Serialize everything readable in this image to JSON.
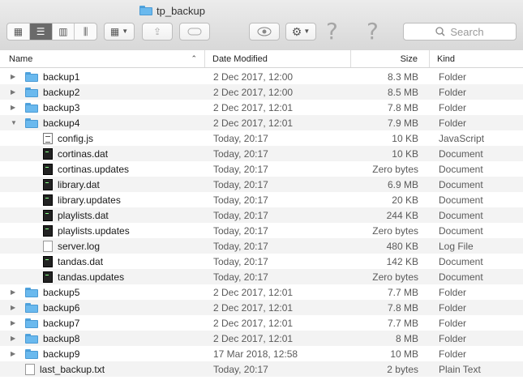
{
  "window": {
    "title": "tp_backup",
    "search_placeholder": "Search"
  },
  "columns": {
    "name": "Name",
    "date": "Date Modified",
    "size": "Size",
    "kind": "Kind"
  },
  "rows": [
    {
      "name": "backup1",
      "date": "2 Dec 2017, 12:00",
      "size": "8.3 MB",
      "kind": "Folder",
      "type": "folder",
      "level": 0,
      "expanded": false
    },
    {
      "name": "backup2",
      "date": "2 Dec 2017, 12:00",
      "size": "8.5 MB",
      "kind": "Folder",
      "type": "folder",
      "level": 0,
      "expanded": false
    },
    {
      "name": "backup3",
      "date": "2 Dec 2017, 12:01",
      "size": "7.8 MB",
      "kind": "Folder",
      "type": "folder",
      "level": 0,
      "expanded": false
    },
    {
      "name": "backup4",
      "date": "2 Dec 2017, 12:01",
      "size": "7.9 MB",
      "kind": "Folder",
      "type": "folder",
      "level": 0,
      "expanded": true
    },
    {
      "name": "config.js",
      "date": "Today, 20:17",
      "size": "10 KB",
      "kind": "JavaScript",
      "type": "js",
      "level": 1
    },
    {
      "name": "cortinas.dat",
      "date": "Today, 20:17",
      "size": "10 KB",
      "kind": "Document",
      "type": "term",
      "level": 1
    },
    {
      "name": "cortinas.updates",
      "date": "Today, 20:17",
      "size": "Zero bytes",
      "kind": "Document",
      "type": "term",
      "level": 1
    },
    {
      "name": "library.dat",
      "date": "Today, 20:17",
      "size": "6.9 MB",
      "kind": "Document",
      "type": "term",
      "level": 1
    },
    {
      "name": "library.updates",
      "date": "Today, 20:17",
      "size": "20 KB",
      "kind": "Document",
      "type": "term",
      "level": 1
    },
    {
      "name": "playlists.dat",
      "date": "Today, 20:17",
      "size": "244 KB",
      "kind": "Document",
      "type": "term",
      "level": 1
    },
    {
      "name": "playlists.updates",
      "date": "Today, 20:17",
      "size": "Zero bytes",
      "kind": "Document",
      "type": "term",
      "level": 1
    },
    {
      "name": "server.log",
      "date": "Today, 20:17",
      "size": "480 KB",
      "kind": "Log File",
      "type": "plain",
      "level": 1
    },
    {
      "name": "tandas.dat",
      "date": "Today, 20:17",
      "size": "142 KB",
      "kind": "Document",
      "type": "term",
      "level": 1
    },
    {
      "name": "tandas.updates",
      "date": "Today, 20:17",
      "size": "Zero bytes",
      "kind": "Document",
      "type": "term",
      "level": 1
    },
    {
      "name": "backup5",
      "date": "2 Dec 2017, 12:01",
      "size": "7.7 MB",
      "kind": "Folder",
      "type": "folder",
      "level": 0,
      "expanded": false
    },
    {
      "name": "backup6",
      "date": "2 Dec 2017, 12:01",
      "size": "7.8 MB",
      "kind": "Folder",
      "type": "folder",
      "level": 0,
      "expanded": false
    },
    {
      "name": "backup7",
      "date": "2 Dec 2017, 12:01",
      "size": "7.7 MB",
      "kind": "Folder",
      "type": "folder",
      "level": 0,
      "expanded": false
    },
    {
      "name": "backup8",
      "date": "2 Dec 2017, 12:01",
      "size": "8 MB",
      "kind": "Folder",
      "type": "folder",
      "level": 0,
      "expanded": false
    },
    {
      "name": "backup9",
      "date": "17 Mar 2018, 12:58",
      "size": "10 MB",
      "kind": "Folder",
      "type": "folder",
      "level": 0,
      "expanded": false
    },
    {
      "name": "last_backup.txt",
      "date": "Today, 20:17",
      "size": "2 bytes",
      "kind": "Plain Text",
      "type": "plain",
      "level": 0
    }
  ]
}
